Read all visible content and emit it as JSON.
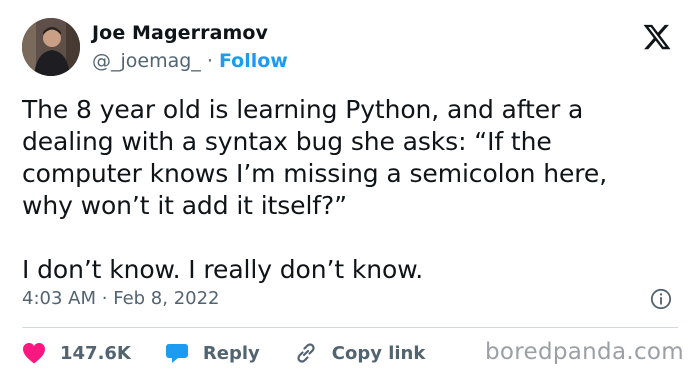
{
  "author": {
    "name": "Joe Magerramov",
    "handle": "@_joemag_",
    "separator": "·",
    "follow_label": "Follow"
  },
  "tweet": {
    "text": "The 8 year old is learning Python, and after a\ndealing with a syntax bug she asks: “If the\ncomputer knows I’m missing a semicolon here,\nwhy won’t it add it itself?”\n\nI don’t know. I really don’t know.",
    "time": "4:03 AM",
    "date": "Feb 8, 2022"
  },
  "actions": {
    "likes": "147.6K",
    "reply_label": "Reply",
    "copy_label": "Copy link"
  },
  "colors": {
    "accent": "#1d9bf0",
    "like": "#f91880",
    "muted": "#536471"
  },
  "icons": [
    "x-logo-icon",
    "info-icon",
    "heart-icon",
    "reply-icon",
    "link-icon"
  ],
  "watermark": "boredpanda.com"
}
